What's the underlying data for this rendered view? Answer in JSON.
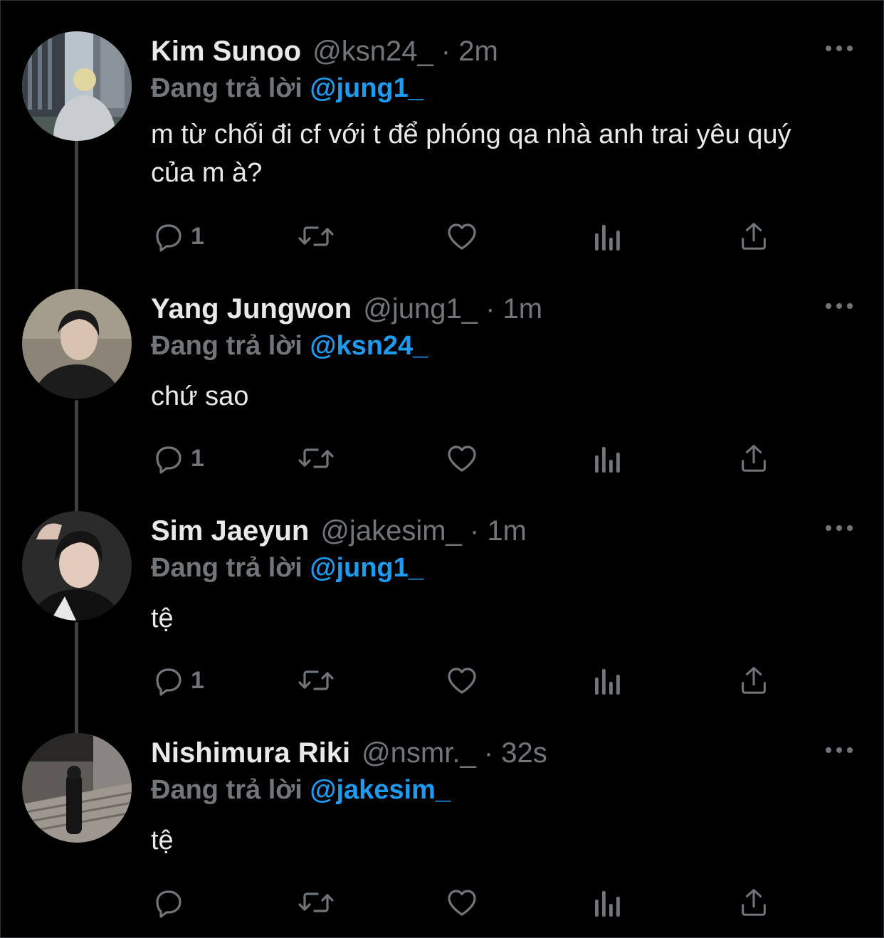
{
  "colors": {
    "background": "#000000",
    "text": "#e7e9ea",
    "muted": "#71767b",
    "accent": "#1d9bf0",
    "thread_line": "#3e4144"
  },
  "reply_prefix": "Đang trả lời",
  "tweets": [
    {
      "display_name": "Kim Sunoo",
      "meta": "@ksn24_ · 2m",
      "replying_to": "@jung1_",
      "text": "m từ chối đi cf với t để phóng qa nhà anh trai yêu quý của m à?",
      "reply_count": "1"
    },
    {
      "display_name": "Yang Jungwon",
      "meta": "@jung1_ · 1m",
      "replying_to": "@ksn24_",
      "text": "chứ sao",
      "reply_count": "1"
    },
    {
      "display_name": "Sim Jaeyun",
      "meta": "@jakesim_ · 1m",
      "replying_to": "@jung1_",
      "text": "tệ",
      "reply_count": "1"
    },
    {
      "display_name": "Nishimura Riki",
      "meta": "@nsmr._ · 32s",
      "replying_to": "@jakesim_",
      "text": "tệ",
      "reply_count": ""
    }
  ],
  "icons": {
    "reply": "reply-icon",
    "retweet": "retweet-icon",
    "like": "heart-icon",
    "views": "analytics-icon",
    "share": "share-icon",
    "more": "more-icon"
  }
}
